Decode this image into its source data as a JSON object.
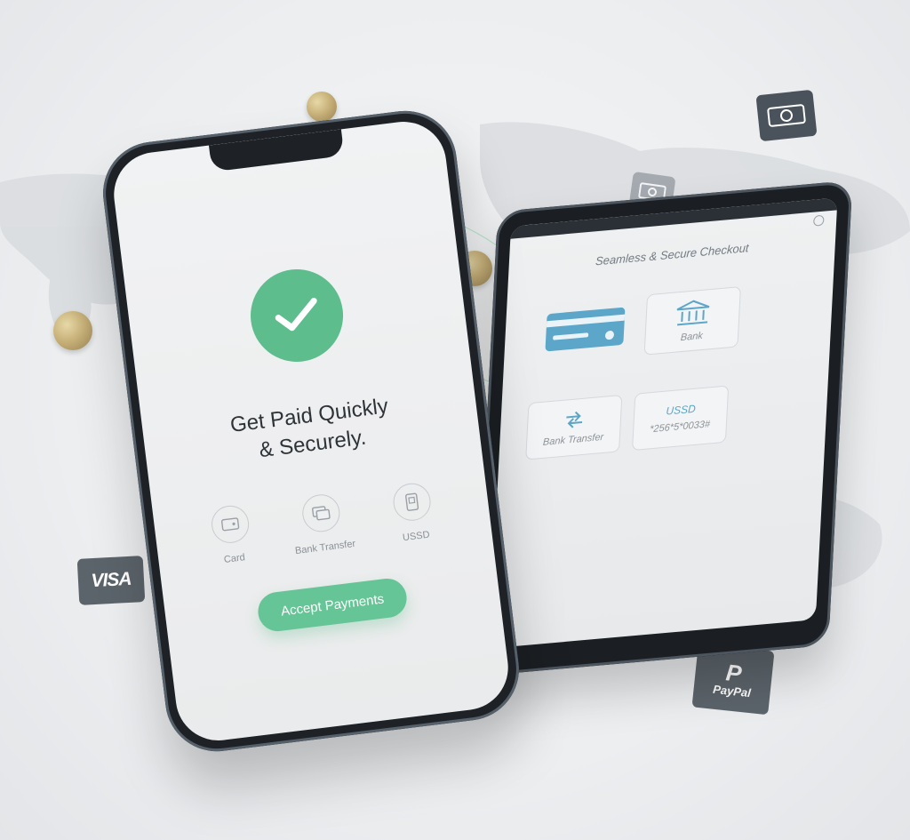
{
  "phone": {
    "headline_line1": "Get Paid Quickly",
    "headline_line2": "& Securely.",
    "methods": [
      {
        "label": "Card",
        "icon": "wallet-icon"
      },
      {
        "label": "Bank Transfer",
        "icon": "bank-transfer-icon"
      },
      {
        "label": "USSD",
        "icon": "phone-icon"
      }
    ],
    "accept_label": "Accept Payments",
    "accent": "#5dbd8c"
  },
  "tablet": {
    "title": "Seamless & Secure Checkout",
    "tiles": {
      "card": {
        "icon": "credit-card-icon"
      },
      "bank": {
        "label": "Bank",
        "icon": "bank-icon"
      },
      "transfer": {
        "label": "Bank Transfer",
        "icon": "transfer-icon"
      },
      "ussd": {
        "label": "USSD",
        "code": "*256*5*0033#"
      }
    },
    "accent": "#5ba6c9"
  },
  "floating": {
    "visa_label": "VISA",
    "paypal_label": "PayPal"
  }
}
